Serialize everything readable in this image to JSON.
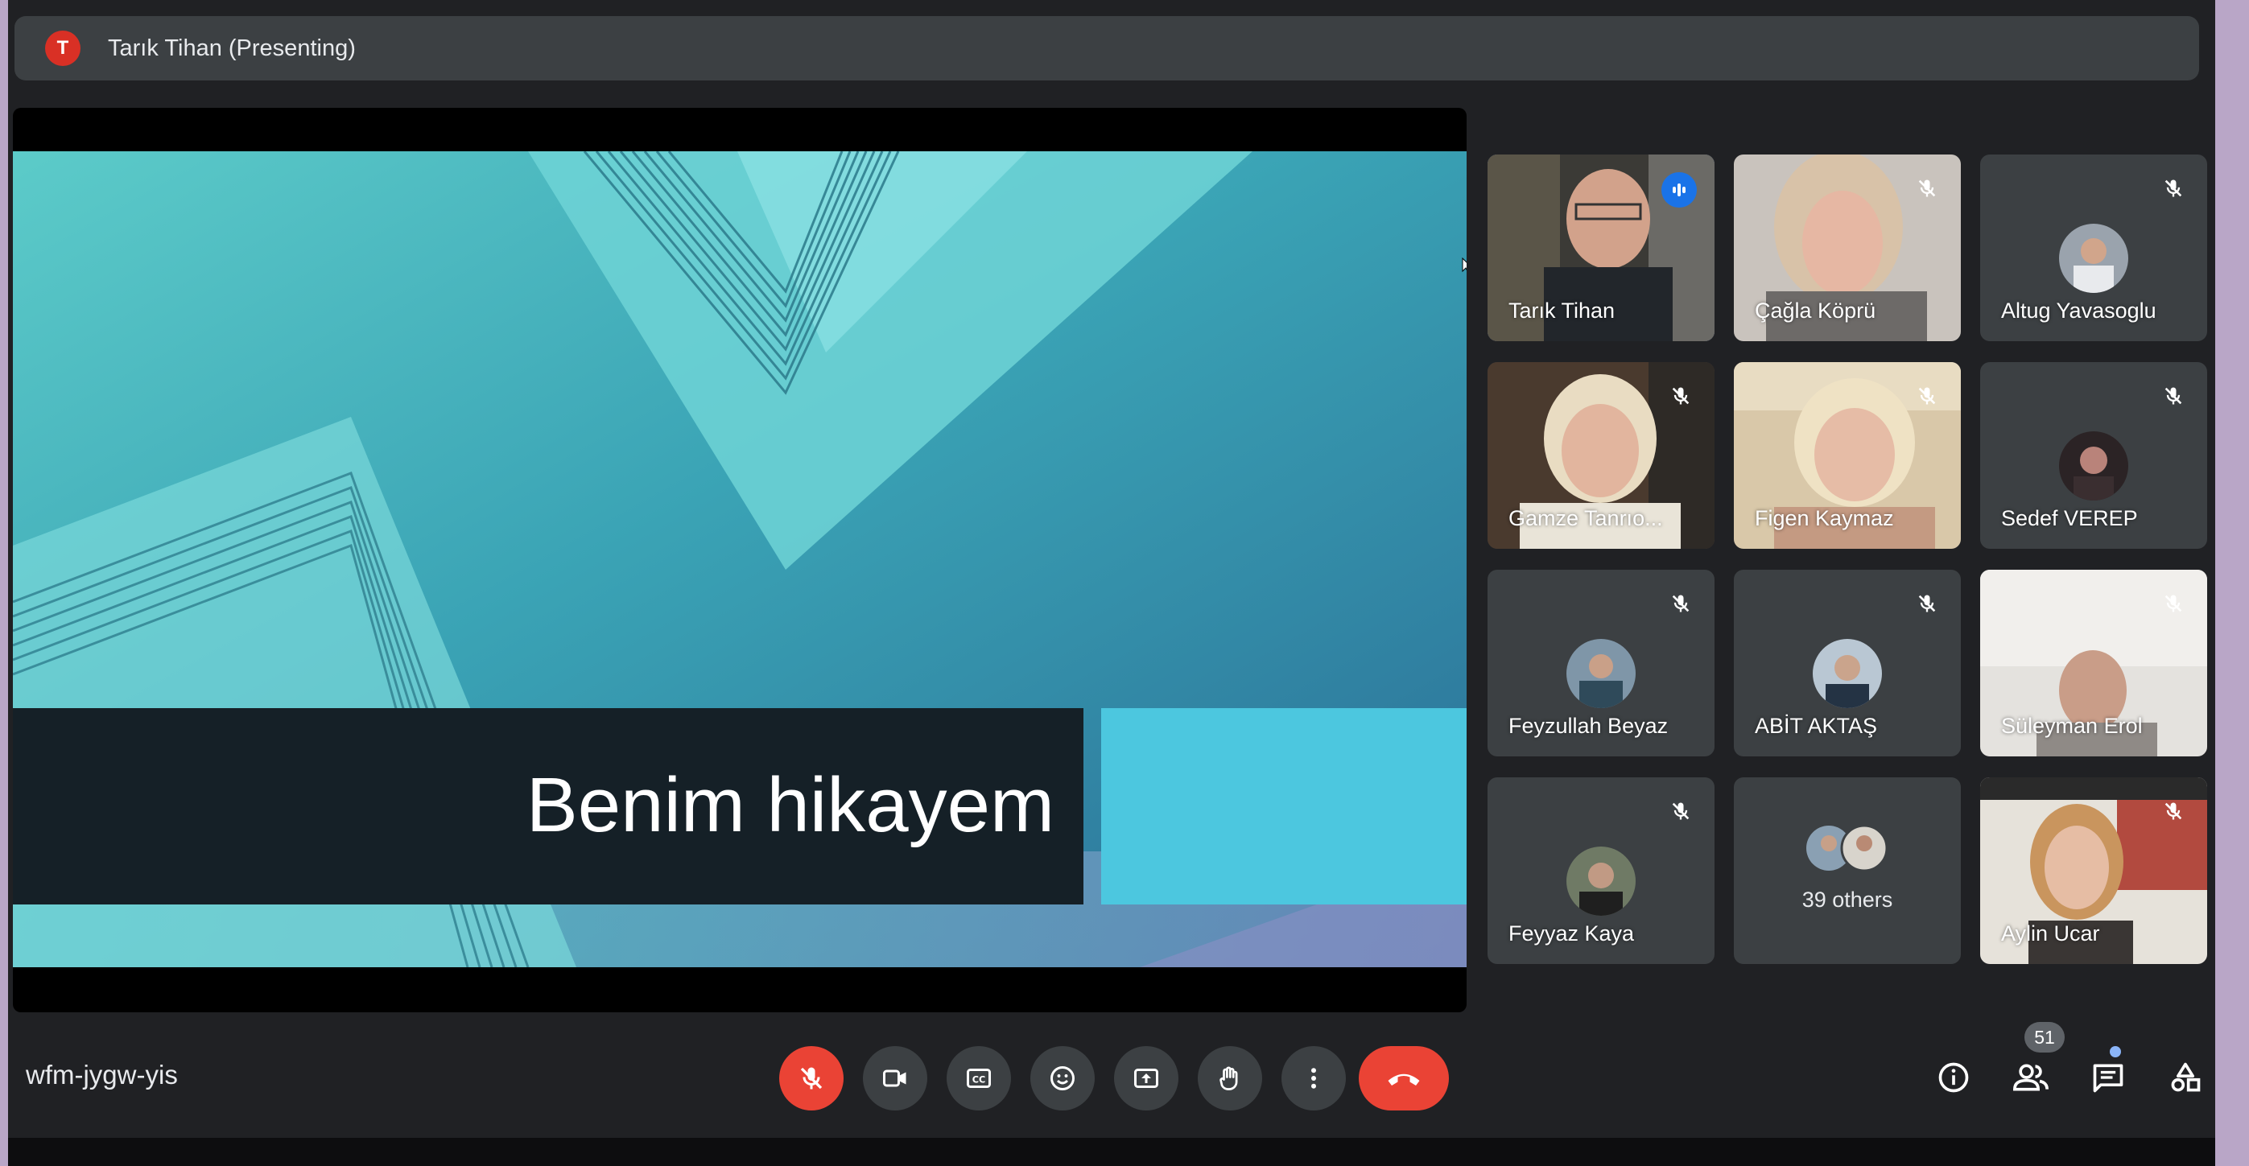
{
  "presenting_bar": {
    "avatar_letter": "T",
    "label": "Tarık Tihan (Presenting)"
  },
  "slide": {
    "title": "Benim hikayem"
  },
  "participants": [
    {
      "name": "Tarık Tihan",
      "state": "speaking",
      "view": "video"
    },
    {
      "name": "Çağla Köprü",
      "state": "muted",
      "view": "video"
    },
    {
      "name": "Altug Yavasoglu",
      "state": "muted",
      "view": "avatar"
    },
    {
      "name": "Gamze Tanrıo...",
      "state": "muted",
      "view": "video"
    },
    {
      "name": "Figen Kaymaz",
      "state": "muted",
      "view": "video"
    },
    {
      "name": "Sedef VEREP",
      "state": "muted",
      "view": "avatar"
    },
    {
      "name": "Feyzullah Beyaz",
      "state": "muted",
      "view": "avatar"
    },
    {
      "name": "ABİT AKTAŞ",
      "state": "muted",
      "view": "avatar"
    },
    {
      "name": "Süleyman Erol",
      "state": "muted",
      "view": "video"
    },
    {
      "name": "Feyyaz Kaya",
      "state": "muted",
      "view": "avatar"
    },
    {
      "name": "39 others",
      "state": "group",
      "view": "group"
    },
    {
      "name": "Aylin Ucar",
      "state": "muted",
      "view": "video"
    }
  ],
  "meeting": {
    "code": "wfm-jygw-yis"
  },
  "controls": {
    "microphone": {
      "icon": "mic-off-icon",
      "state": "off"
    },
    "camera": {
      "icon": "camera-icon"
    },
    "captions": {
      "icon": "captions-icon"
    },
    "reactions": {
      "icon": "emoji-icon"
    },
    "present": {
      "icon": "present-screen-icon"
    },
    "raise_hand": {
      "icon": "hand-icon"
    },
    "more": {
      "icon": "more-vert-icon"
    },
    "end_call": {
      "icon": "end-call-icon"
    }
  },
  "right_controls": {
    "info": {
      "icon": "info-icon"
    },
    "people": {
      "icon": "people-icon",
      "count": "51"
    },
    "chat": {
      "icon": "chat-icon",
      "unread": true
    },
    "activities": {
      "icon": "activities-icon"
    }
  },
  "colors": {
    "background": "#202124",
    "tile": "#3c4043",
    "accent_blue": "#8ab4f8",
    "red": "#ea4335",
    "page_border": "#b9a6c7"
  }
}
